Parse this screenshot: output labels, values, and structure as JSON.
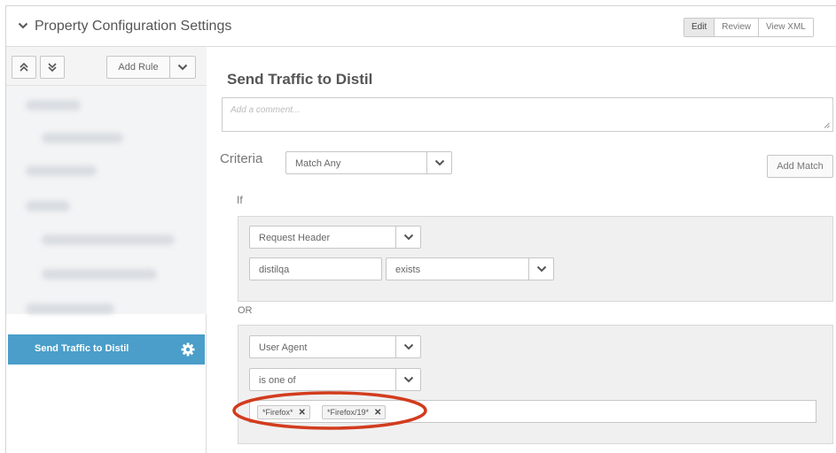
{
  "header": {
    "title": "Property Configuration Settings",
    "modes": [
      {
        "label": "Edit",
        "active": true
      },
      {
        "label": "Review",
        "active": false
      },
      {
        "label": "View XML",
        "active": false
      }
    ]
  },
  "sidebar": {
    "add_rule_label": "Add Rule",
    "selected_rule": "Send Traffic to Distil"
  },
  "rule": {
    "title": "Send Traffic to Distil",
    "comment_placeholder": "Add a comment...",
    "criteria_label": "Criteria",
    "match_mode": "Match Any",
    "add_match_label": "Add Match",
    "if_label": "If",
    "or_label": "OR",
    "conditions": [
      {
        "match_type": "Request Header",
        "header_name": "distilqa",
        "operator": "exists"
      },
      {
        "match_type": "User Agent",
        "operator": "is one of",
        "values": [
          "*Firefox*",
          "*Firefox/19*"
        ]
      }
    ]
  },
  "colors": {
    "selected_rule_bg": "#4a9ec9",
    "highlight_ellipse": "#d23c1e"
  },
  "icons": [
    "chevron-down-icon",
    "double-chevron-up-icon",
    "double-chevron-down-icon",
    "gear-icon",
    "remove-x-icon",
    "resize-grip-icon"
  ]
}
